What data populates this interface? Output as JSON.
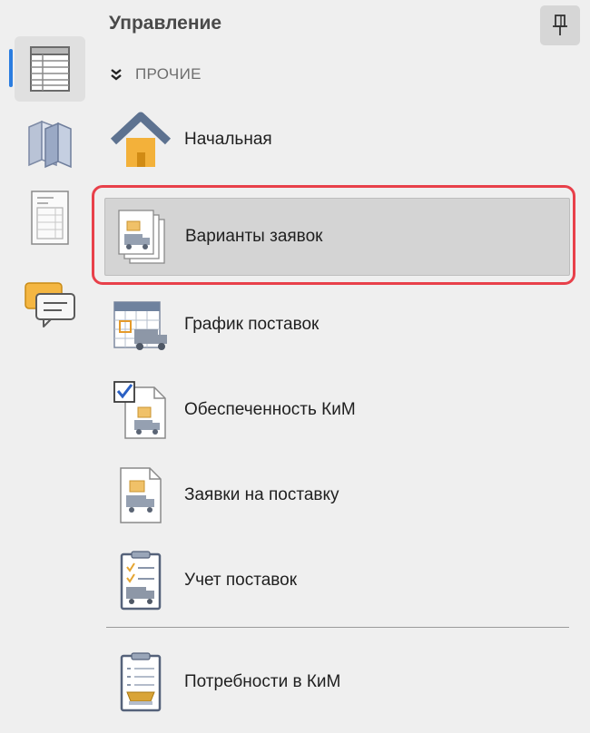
{
  "header": {
    "title": "Управление",
    "pin_icon": "pin-icon"
  },
  "section": {
    "label": "ПРОЧИЕ",
    "icon": "double-chevron-down-icon"
  },
  "rail": {
    "items": [
      {
        "icon": "table-icon",
        "active": true
      },
      {
        "icon": "books-icon",
        "active": false
      },
      {
        "icon": "document-icon",
        "active": false
      },
      {
        "icon": "chat-icon",
        "active": false
      }
    ],
    "accent": "#2b7de0"
  },
  "items": [
    {
      "label": "Начальная",
      "icon": "home-icon"
    },
    {
      "label": "Варианты заявок",
      "icon": "request-variants-icon",
      "selected": true
    },
    {
      "label": "График поставок",
      "icon": "delivery-schedule-icon"
    },
    {
      "label": "Обеспеченность КиМ",
      "icon": "supply-coverage-icon"
    },
    {
      "label": "Заявки на поставку",
      "icon": "supply-requests-icon"
    },
    {
      "label": "Учет поставок",
      "icon": "delivery-accounting-icon"
    },
    {
      "label": "Потребности в КиМ",
      "icon": "needs-icon"
    }
  ],
  "colors": {
    "highlight": "#e8404a",
    "selected_bg": "#d4d4d4"
  }
}
